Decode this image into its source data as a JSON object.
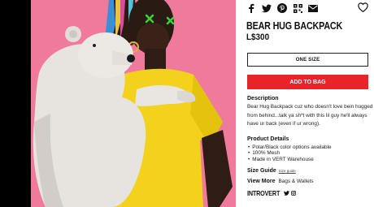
{
  "share_icons": [
    "facebook-icon",
    "twitter-icon",
    "pinterest-icon",
    "qr-icon",
    "mail-icon"
  ],
  "favorite_icon": "heart-icon",
  "product": {
    "title": "BEAR HUG BACKPACK",
    "price": "L$300"
  },
  "size_button_label": "ONE SIZE",
  "add_button_label": "ADD TO BAG",
  "description": {
    "heading": "Description",
    "text": "Bear Hug Backpack cuz who doesn't love bein hugged from behind...talk ya sh*t with this lil guy he'll always have ur back (even if ur wrong)."
  },
  "details": {
    "heading": "Product Details",
    "items": [
      "Polar/Black color options available",
      "100% Mesh",
      "Made in VERT Warehouse"
    ]
  },
  "size_guide": {
    "label": "Size Guide",
    "link": "Size guide"
  },
  "view_more": {
    "label": "View More",
    "link": "Bags & Wallets"
  },
  "brand": {
    "name": "INTROVERT",
    "icons": [
      "twitter-icon",
      "instagram-icon"
    ]
  },
  "colors": {
    "accent_red": "#e8232a",
    "pink_background": "#ef7a9c",
    "shirt_yellow": "#f2d21c",
    "text": "#111111"
  }
}
